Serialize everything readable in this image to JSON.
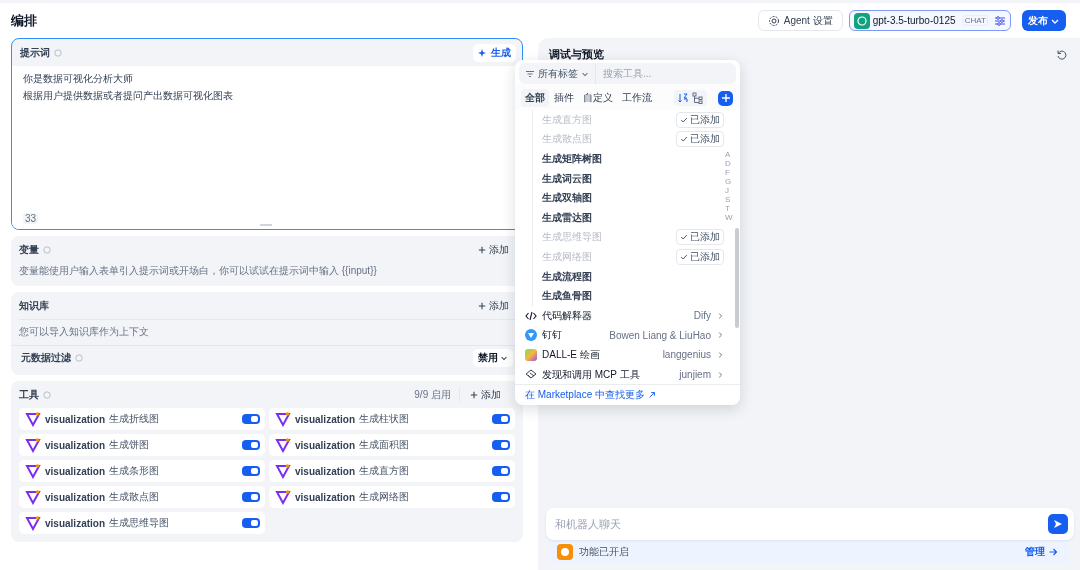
{
  "header": {
    "title": "编排",
    "agent_settings": "Agent 设置",
    "model": {
      "name": "gpt-3.5-turbo-0125",
      "tag": "CHAT"
    },
    "publish": "发布"
  },
  "prompt": {
    "label": "提示词",
    "generate": "生成",
    "lines": [
      "你是数据可视化分析大师",
      "根据用户提供数据或者提问产出数据可视化图表"
    ],
    "count": "33"
  },
  "variables": {
    "label": "变量",
    "add": "添加",
    "description": "变量能使用户输入表单引入提示词或开场白，你可以试试在提示词中输入 {{input}}"
  },
  "knowledge": {
    "label": "知识库",
    "add": "添加",
    "description": "您可以导入知识库作为上下文",
    "metadata_filter": {
      "label": "元数据过滤",
      "value": "禁用"
    }
  },
  "tools": {
    "label": "工具",
    "enabled_count": "9/9 启用",
    "add": "添加",
    "items": [
      {
        "provider": "visualization",
        "name": "生成折线图",
        "on": true
      },
      {
        "provider": "visualization",
        "name": "生成柱状图",
        "on": true
      },
      {
        "provider": "visualization",
        "name": "生成饼图",
        "on": true
      },
      {
        "provider": "visualization",
        "name": "生成面积图",
        "on": true
      },
      {
        "provider": "visualization",
        "name": "生成条形图",
        "on": true
      },
      {
        "provider": "visualization",
        "name": "生成直方图",
        "on": true
      },
      {
        "provider": "visualization",
        "name": "生成散点图",
        "on": true
      },
      {
        "provider": "visualization",
        "name": "生成网络图",
        "on": true
      },
      {
        "provider": "visualization",
        "name": "生成思维导图",
        "on": true
      }
    ]
  },
  "preview": {
    "title": "调试与预览"
  },
  "chat": {
    "placeholder": "和机器人聊天",
    "features": "功能已开启",
    "manage": "管理"
  },
  "tool_picker": {
    "tag_filter": "所有标签",
    "search_placeholder": "搜索工具...",
    "tabs": [
      {
        "label": "全部",
        "selected": true
      },
      {
        "label": "插件",
        "selected": false
      },
      {
        "label": "自定义",
        "selected": false
      },
      {
        "label": "工作流",
        "selected": false
      }
    ],
    "index_letters": [
      "A",
      "D",
      "F",
      "G",
      "J",
      "S",
      "T",
      "W"
    ],
    "subitems": [
      {
        "name": "生成直方图",
        "added": true,
        "added_label": "已添加"
      },
      {
        "name": "生成散点图",
        "added": true,
        "added_label": "已添加"
      },
      {
        "name": "生成矩阵树图",
        "added": false
      },
      {
        "name": "生成词云图",
        "added": false
      },
      {
        "name": "生成双轴图",
        "added": false
      },
      {
        "name": "生成雷达图",
        "added": false
      },
      {
        "name": "生成思维导图",
        "added": true,
        "added_label": "已添加"
      },
      {
        "name": "生成网络图",
        "added": true,
        "added_label": "已添加"
      },
      {
        "name": "生成流程图",
        "added": false
      },
      {
        "name": "生成鱼骨图",
        "added": false
      }
    ],
    "providers": [
      {
        "kind": "code",
        "name": "代码解释器",
        "author": "Dify"
      },
      {
        "kind": "dingtalk",
        "name": "钉钉",
        "author": "Bowen Liang & LiuHao"
      },
      {
        "kind": "dalle",
        "name": "DALL-E 绘画",
        "author": "langgenius"
      },
      {
        "kind": "mcp",
        "name": "发现和调用 MCP 工具",
        "author": "junjiem"
      }
    ],
    "marketplace_link": "在 Marketplace 中查找更多"
  }
}
